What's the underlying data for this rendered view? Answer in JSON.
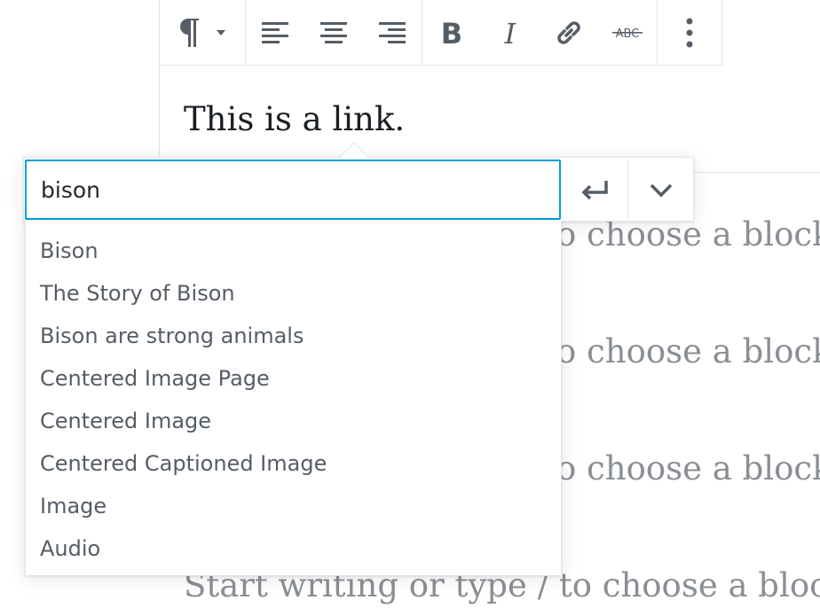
{
  "toolbar": {
    "buttons": [
      {
        "name": "paragraph-icon",
        "label": "Paragraph"
      },
      {
        "name": "align-left-icon",
        "label": "Align left"
      },
      {
        "name": "align-center-icon",
        "label": "Align center"
      },
      {
        "name": "align-right-icon",
        "label": "Align right"
      },
      {
        "name": "bold-icon",
        "label": "Bold"
      },
      {
        "name": "italic-icon",
        "label": "Italic"
      },
      {
        "name": "link-icon",
        "label": "Link"
      },
      {
        "name": "strikethrough-icon",
        "label": "ABC"
      },
      {
        "name": "more-vertical-icon",
        "label": "More"
      }
    ]
  },
  "editor": {
    "paragraph": "This is a link.",
    "placeholder_partial": "o choose a block",
    "placeholder_full": "Start writing or type / to choose a block"
  },
  "link_popover": {
    "input_value": "bison",
    "submit_icon": "enter-icon",
    "toggle_icon": "chevron-down-icon",
    "suggestions": [
      "Bison",
      "The Story of Bison",
      "Bison are strong animals",
      "Centered Image Page",
      "Centered Image",
      "Centered Captioned Image",
      "Image",
      "Audio"
    ]
  },
  "colors": {
    "focus": "#00a0d2",
    "icon": "#555d66",
    "placeholder": "#8a8f95",
    "text": "#191e23"
  }
}
